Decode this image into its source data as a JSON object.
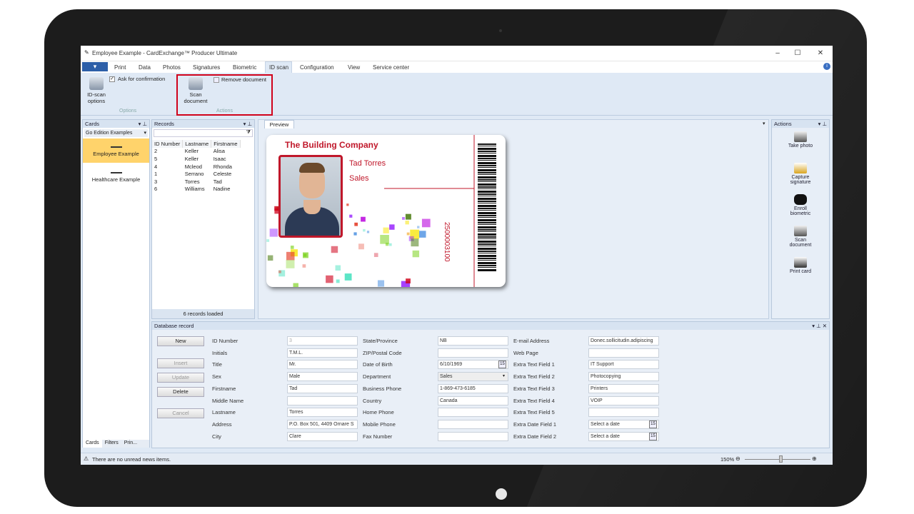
{
  "window": {
    "title": "Employee Example - CardExchange™ Producer Ultimate",
    "minimize": "–",
    "maximize": "☐",
    "close": "✕"
  },
  "menu": {
    "file": "▾",
    "items": [
      "Print",
      "Data",
      "Photos",
      "Signatures",
      "Biometric",
      "ID scan",
      "Configuration",
      "View",
      "Service center"
    ]
  },
  "ribbon": {
    "idscan_options": "ID-scan options",
    "ask_confirmation": "Ask for confirmation",
    "options_group": "Options",
    "scan_document": "Scan document",
    "remove_document": "Remove document",
    "actions_group": "Actions"
  },
  "cards_panel": {
    "title": "Cards",
    "edition": "Go Edition Examples",
    "items": [
      "Employee Example",
      "Healthcare Example"
    ],
    "tabs": [
      "Cards",
      "Filters",
      "Prin..."
    ]
  },
  "records_panel": {
    "title": "Records",
    "columns": [
      "ID Number",
      "Lastname",
      "Firstname"
    ],
    "rows": [
      [
        "2",
        "Keller",
        "Alisa"
      ],
      [
        "5",
        "Keller",
        "Isaac"
      ],
      [
        "4",
        "Mcleod",
        "Rhonda"
      ],
      [
        "1",
        "Serrano",
        "Celeste"
      ],
      [
        "3",
        "Torres",
        "Tad"
      ],
      [
        "6",
        "Williams",
        "Nadine"
      ]
    ],
    "status": "6 records loaded"
  },
  "preview": {
    "tab": "Preview",
    "company": "The Building Company",
    "name": "Tad Torres",
    "department": "Sales",
    "barcode_number": "2500003100"
  },
  "actions_panel": {
    "title": "Actions",
    "items": [
      "Take photo",
      "Capture signature",
      "Enroll biometric",
      "Scan document",
      "Print card"
    ]
  },
  "db_record": {
    "title": "Database record",
    "buttons": [
      "New",
      "Insert",
      "Update",
      "Delete",
      "Cancel"
    ],
    "col1": [
      [
        "ID Number",
        "3"
      ],
      [
        "Initials",
        "T.M.L."
      ],
      [
        "Title",
        "Mr."
      ],
      [
        "Sex",
        "Male"
      ],
      [
        "Firstname",
        "Tad"
      ],
      [
        "Middle Name",
        ""
      ],
      [
        "Lastname",
        "Torres"
      ],
      [
        "Address",
        "P.O. Box 501, 4409 Ornare S"
      ],
      [
        "City",
        "Clare"
      ]
    ],
    "col2": [
      [
        "State/Province",
        "NB"
      ],
      [
        "ZIP/Postal Code",
        ""
      ],
      [
        "Date of Birth",
        "6/10/1969"
      ],
      [
        "Department",
        "Sales"
      ],
      [
        "Business Phone",
        "1-869-473-6185"
      ],
      [
        "Country",
        "Canada"
      ],
      [
        "Home Phone",
        ""
      ],
      [
        "Mobile Phone",
        ""
      ],
      [
        "Fax Number",
        ""
      ]
    ],
    "col3": [
      [
        "E-mail Address",
        "Donec.sollicitudin.adipiscing"
      ],
      [
        "Web Page",
        ""
      ],
      [
        "Extra Text Field 1",
        "IT Support"
      ],
      [
        "Extra Text Field 2",
        "Photocopying"
      ],
      [
        "Extra Text Field 3",
        "Printers"
      ],
      [
        "Extra Text Field 4",
        "VOIP"
      ],
      [
        "Extra Text Field 5",
        ""
      ],
      [
        "Extra Date Field 1",
        "Select a date"
      ],
      [
        "Extra Date Field 2",
        "Select a date"
      ]
    ],
    "calendar": "15"
  },
  "statusbar": {
    "message": "There are no unread news items.",
    "zoom": "150%"
  },
  "colors": {
    "accent": "#2d5fa8",
    "highlight": "#d0021b",
    "card_title": "#c0172a",
    "selected": "#ffd36b"
  }
}
